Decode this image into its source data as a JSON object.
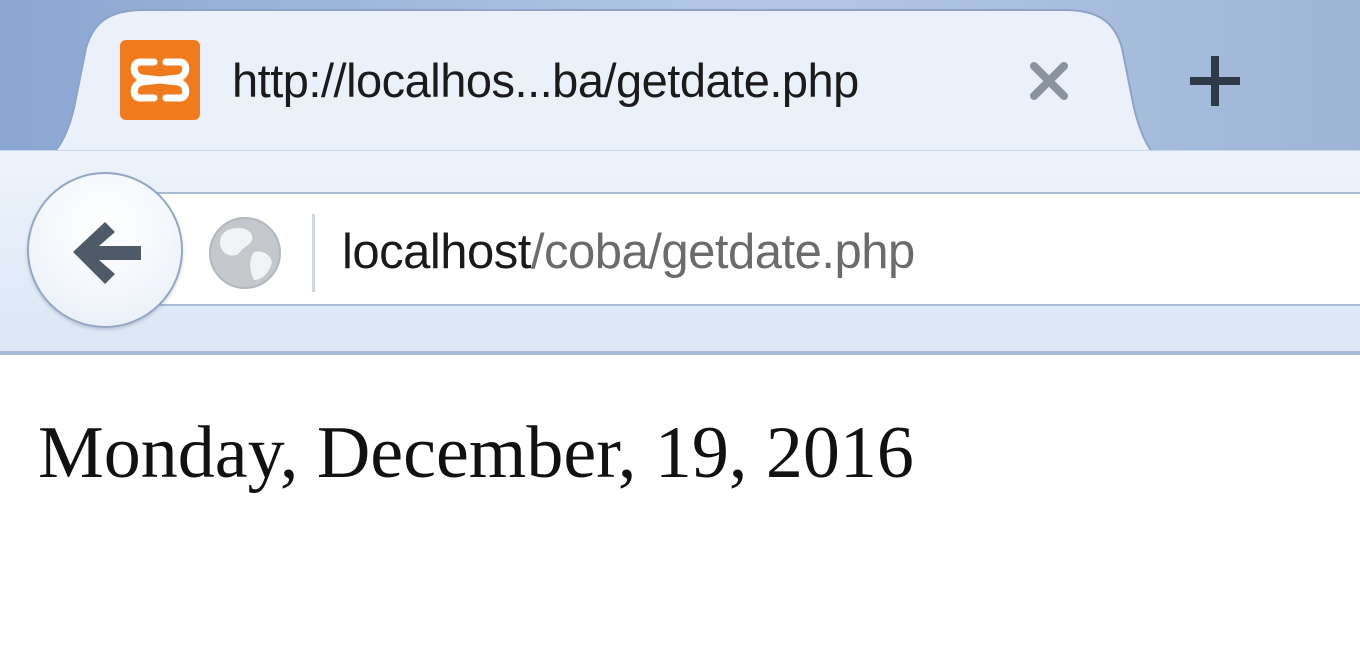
{
  "browser": {
    "tab": {
      "title": "http://localhos...ba/getdate.php",
      "favicon": "xampp-icon",
      "close_icon": "close-icon"
    },
    "new_tab_icon": "plus-icon",
    "back_icon": "back-arrow-icon",
    "site_identity_icon": "globe-icon",
    "url": {
      "host": "localhost",
      "path": "/coba/getdate.php"
    }
  },
  "page": {
    "date_text": "Monday, December, 19, 2016"
  },
  "colors": {
    "favicon_orange": "#f07a1e",
    "tab_background": "#ebf1fa",
    "chrome_blue": "#a5bcde"
  }
}
